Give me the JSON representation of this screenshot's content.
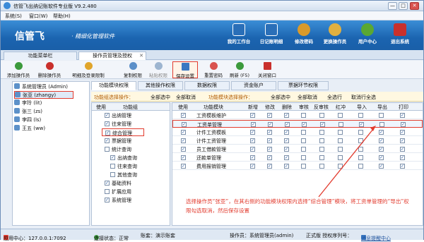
{
  "window": {
    "title": "信管飞出纳记账软件专业版 V9.2.480",
    "min": "—",
    "max": "□",
    "close": "✕"
  },
  "menu": [
    "系统(S)",
    "窗口(W)",
    "帮助(H)"
  ],
  "banner": {
    "logo": "信管飞",
    "subtitle": "· 精细化管理软件",
    "buttons": [
      {
        "label": "我的工作台",
        "icon": "monitor-icon",
        "color": "#2a6fb8"
      },
      {
        "label": "日记账明细",
        "icon": "ledger-icon",
        "color": "#2a6fb8"
      },
      {
        "label": "修改密码",
        "icon": "user-key-icon",
        "color": "#d99a2b"
      },
      {
        "label": "更换操作员",
        "icon": "user-switch-icon",
        "color": "#e0b040"
      },
      {
        "label": "用户中心",
        "icon": "globe-icon",
        "color": "#5aa832"
      },
      {
        "label": "退出系统",
        "icon": "power-icon",
        "color": "#c9302c"
      }
    ]
  },
  "tabs": [
    {
      "label": "功能菜单栏",
      "active": false
    },
    {
      "label": "操作员管理及授权",
      "active": true
    }
  ],
  "toolbar": [
    {
      "label": "添加操作员",
      "color": "#3c9a3c"
    },
    {
      "label": "删除操作员",
      "color": "#c9302c"
    },
    {
      "label": "明细及登录限制",
      "color": "#e0a52b"
    },
    {
      "label": "复制权限",
      "color": "#5b8fc9"
    },
    {
      "label": "粘贴权限",
      "color": "#9db5d0"
    },
    {
      "label": "保存设置",
      "color": "#3a78c2"
    },
    {
      "label": "重置密码",
      "color": "#d9534f"
    },
    {
      "label": "刷新 (F5)",
      "color": "#3c9a3c"
    },
    {
      "label": "关闭窗口",
      "color": "#c9302c"
    }
  ],
  "users": [
    {
      "label": "系统管理员 (Admin)",
      "selected": false
    },
    {
      "label": "张亚 (zhangy)",
      "selected": true
    },
    {
      "label": "李玲 (lit)",
      "selected": false
    },
    {
      "label": "张三 (zs)",
      "selected": false
    },
    {
      "label": "李四 (ls)",
      "selected": false
    },
    {
      "label": "王五 (ww)",
      "selected": false
    }
  ],
  "subtabs": [
    {
      "label": "功能模块权限",
      "active": true
    },
    {
      "label": "其他操作权限",
      "active": false
    },
    {
      "label": "数据权限",
      "active": false
    },
    {
      "label": "资金账户",
      "active": false
    },
    {
      "label": "票据环节权限",
      "active": false
    }
  ],
  "opbar": {
    "grp_title": "功能组选择操作：",
    "grp_all": "全部选中",
    "grp_none": "全部取消",
    "mod_title": "功能模块选择操作：",
    "mod_all": "全部选中",
    "mod_none": "全部取消",
    "mod_row": "全选行",
    "mod_cancel_row": "取消行全选"
  },
  "group_grid": {
    "headers": [
      "使用",
      "功能组"
    ],
    "rows": [
      {
        "label": "出纳管理",
        "checked": true,
        "indent": 1
      },
      {
        "label": "往来管理",
        "checked": true,
        "indent": 1
      },
      {
        "label": "综合管理",
        "checked": true,
        "indent": 1,
        "selected": true
      },
      {
        "label": "票据管理",
        "checked": true,
        "indent": 1
      },
      {
        "label": "统计查询",
        "checked": false,
        "indent": 1
      },
      {
        "label": "出纳查询",
        "checked": true,
        "indent": 2
      },
      {
        "label": "往来查询",
        "checked": false,
        "indent": 2
      },
      {
        "label": "其他查询",
        "checked": false,
        "indent": 2
      },
      {
        "label": "基础资料",
        "checked": true,
        "indent": 1
      },
      {
        "label": "扩展应用",
        "checked": false,
        "indent": 1
      },
      {
        "label": "系统管理",
        "checked": true,
        "indent": 1
      }
    ]
  },
  "module_grid": {
    "headers": [
      "使用",
      "功能模块",
      "新增",
      "修改",
      "删除",
      "审核",
      "反审核",
      "红冲",
      "导入",
      "导出",
      "打印"
    ],
    "rows": [
      {
        "label": "工资模板维护",
        "use": true,
        "c": [
          true,
          true,
          true,
          false,
          false,
          false,
          false,
          false,
          true
        ]
      },
      {
        "label": "工资单管理",
        "use": true,
        "c": [
          true,
          true,
          true,
          true,
          true,
          false,
          true,
          false,
          true
        ],
        "selected": true
      },
      {
        "label": "计件工资模板",
        "use": true,
        "c": [
          true,
          true,
          true,
          false,
          false,
          false,
          false,
          true,
          true
        ]
      },
      {
        "label": "计件工资管理",
        "use": true,
        "c": [
          true,
          true,
          true,
          false,
          false,
          false,
          false,
          true,
          true
        ]
      },
      {
        "label": "员工借款管理",
        "use": true,
        "c": [
          true,
          true,
          true,
          false,
          false,
          false,
          false,
          true,
          true
        ]
      },
      {
        "label": "还款单管理",
        "use": true,
        "c": [
          true,
          true,
          true,
          false,
          false,
          false,
          false,
          true,
          true
        ]
      },
      {
        "label": "费用报销管理",
        "use": true,
        "c": [
          true,
          true,
          true,
          false,
          false,
          false,
          false,
          true,
          true
        ]
      }
    ]
  },
  "note": "选择操作员“张亚”，在其右侧的功能模块权限内选择“综合管理”模块，将工资单管理的“导出”权限勾选取消，然后保存设置",
  "status": {
    "app_center": "应用中心：127.0.0.1:7092",
    "connection": "连接状态：正常",
    "account": "账套：演示账套",
    "operator": "操作员：系统管理员(admin)",
    "edition": "正式版 授权序列号：",
    "tip": "消息提醒中心"
  }
}
